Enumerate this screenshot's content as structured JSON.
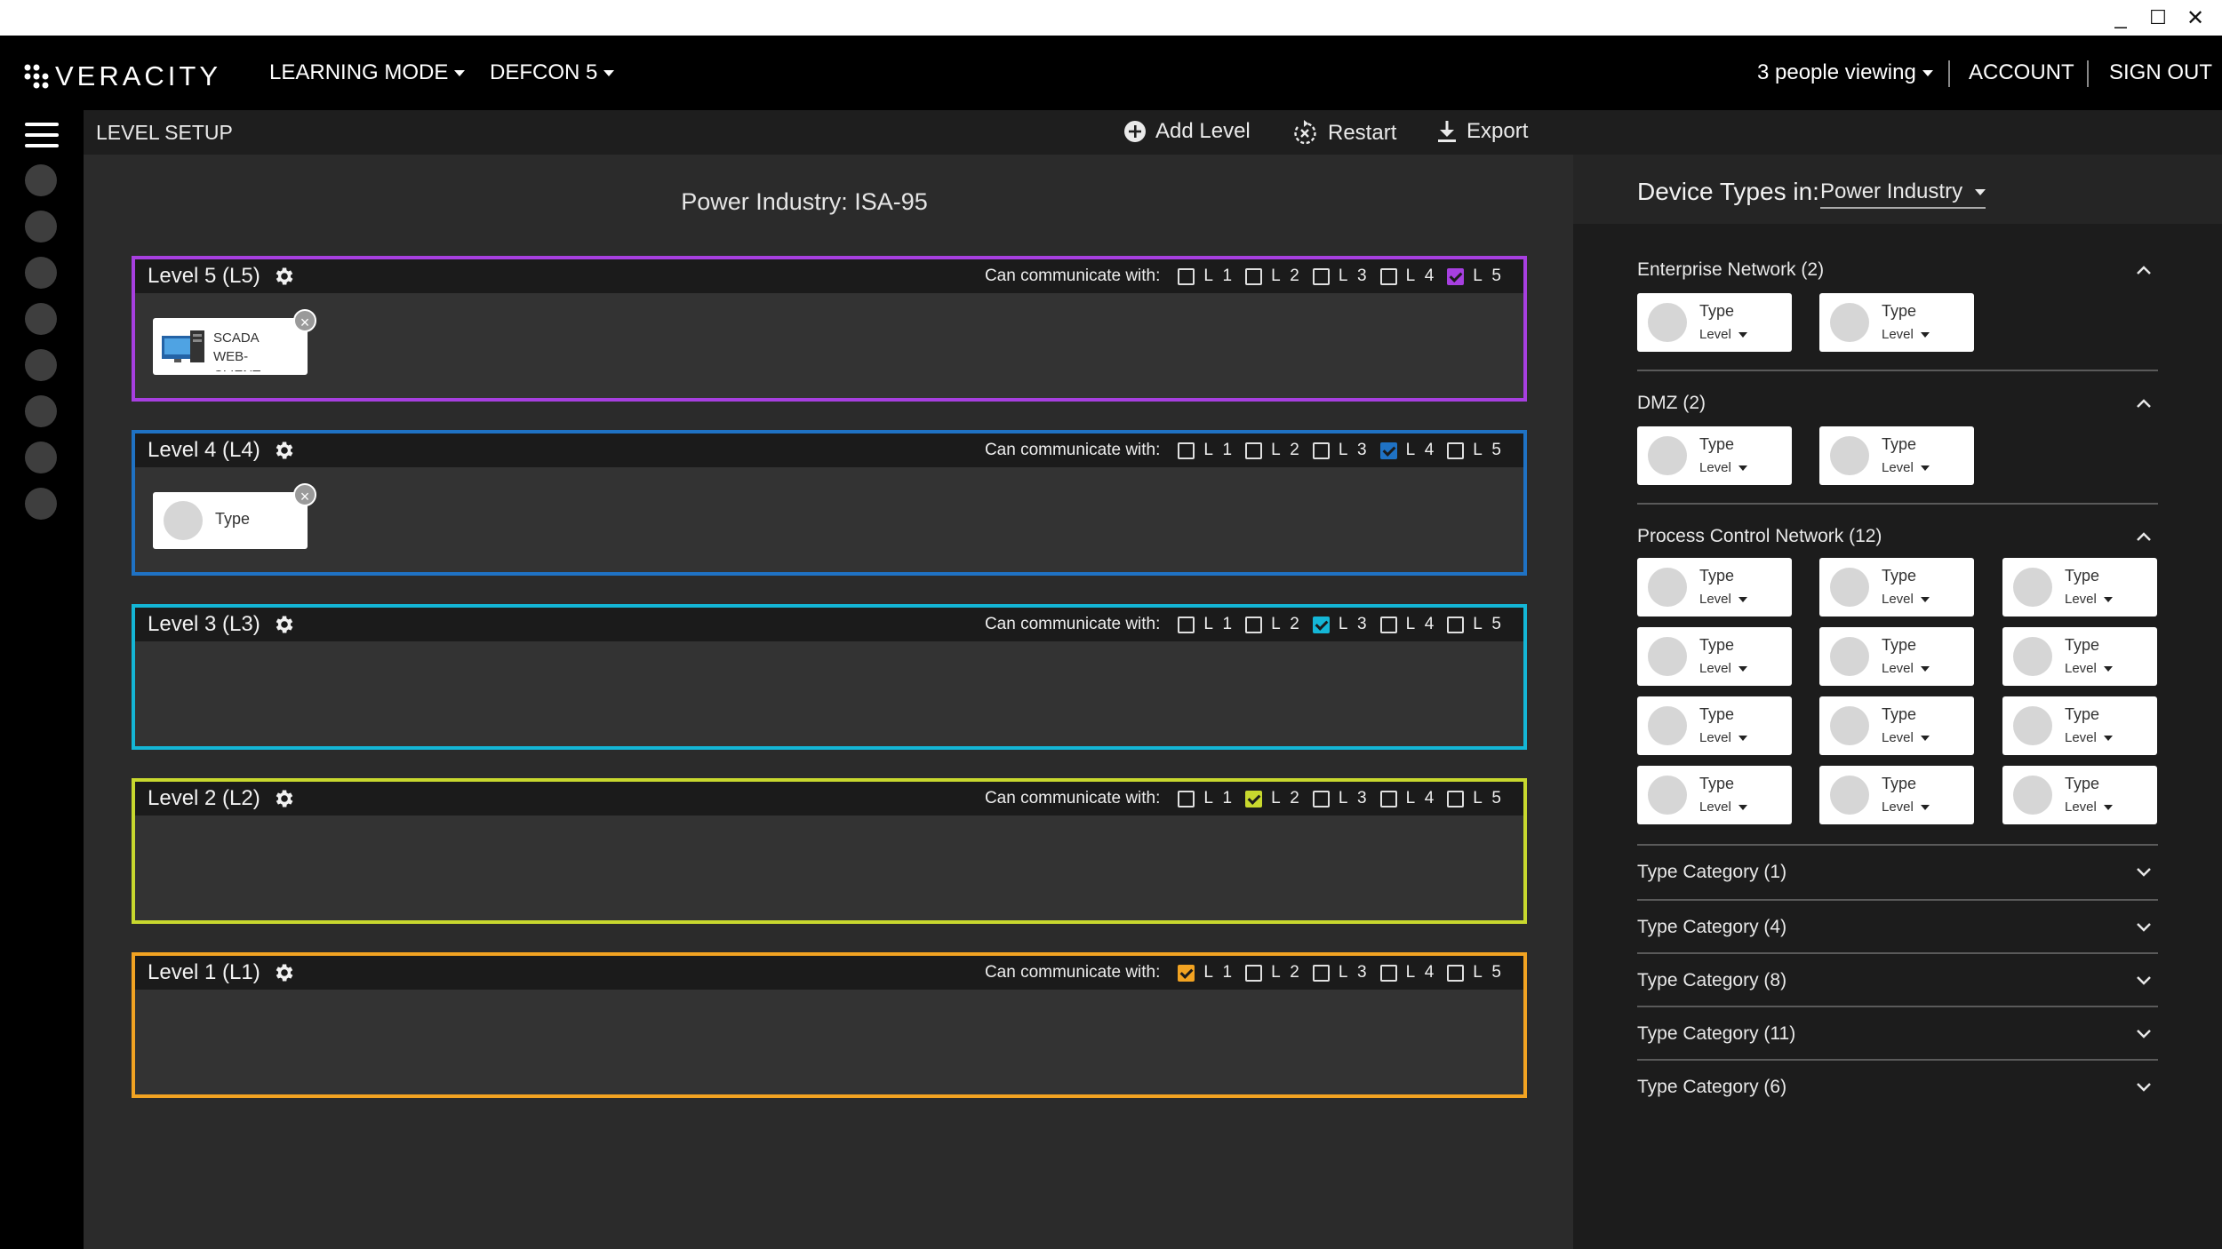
{
  "window": {
    "minimize": "_",
    "maximize": "☐",
    "close": "✕"
  },
  "topnav": {
    "logo": "VERACITY",
    "mode": "LEARNING MODE",
    "defcon": "DEFCON 5",
    "viewers": "3 people viewing",
    "account": "ACCOUNT",
    "signout": "SIGN OUT"
  },
  "toolbar": {
    "title": "LEVEL SETUP",
    "add_level": "Add Level",
    "restart": "Restart",
    "export": "Export"
  },
  "main": {
    "title": "Power Industry: ISA-95",
    "comm_label": "Can communicate with:",
    "checkbox_labels": [
      "L 1",
      "L 2",
      "L 3",
      "L 4",
      "L 5"
    ],
    "levels": [
      {
        "name": "Level 5 (L5)",
        "color": "#a73fe0",
        "checked": [
          false,
          false,
          false,
          false,
          true
        ]
      },
      {
        "name": "Level 4 (L4)",
        "color": "#1f72c4",
        "checked": [
          false,
          false,
          false,
          true,
          false
        ]
      },
      {
        "name": "Level 3 (L3)",
        "color": "#14b6d6",
        "checked": [
          false,
          false,
          true,
          false,
          false
        ]
      },
      {
        "name": "Level 2 (L2)",
        "color": "#c8d82e",
        "checked": [
          false,
          true,
          false,
          false,
          false
        ]
      },
      {
        "name": "Level 1 (L1)",
        "color": "#f2a322",
        "checked": [
          true,
          false,
          false,
          false,
          false
        ]
      }
    ],
    "devices": {
      "scada": "SCADA WEB-CLIENT",
      "type": "Type"
    }
  },
  "right_panel": {
    "title": "Device Types in:",
    "industry": "Power Industry",
    "tile_type": "Type",
    "tile_level": "Level",
    "sections": [
      {
        "label": "Enterprise Network (2)",
        "expanded": true
      },
      {
        "label": "DMZ (2)",
        "expanded": true
      },
      {
        "label": "Process Control Network (12)",
        "expanded": true
      },
      {
        "label": "Type Category (1)",
        "expanded": false
      },
      {
        "label": "Type Category (4)",
        "expanded": false
      },
      {
        "label": "Type Category (8)",
        "expanded": false
      },
      {
        "label": "Type Category (11)",
        "expanded": false
      },
      {
        "label": "Type Category (6)",
        "expanded": false
      }
    ]
  }
}
